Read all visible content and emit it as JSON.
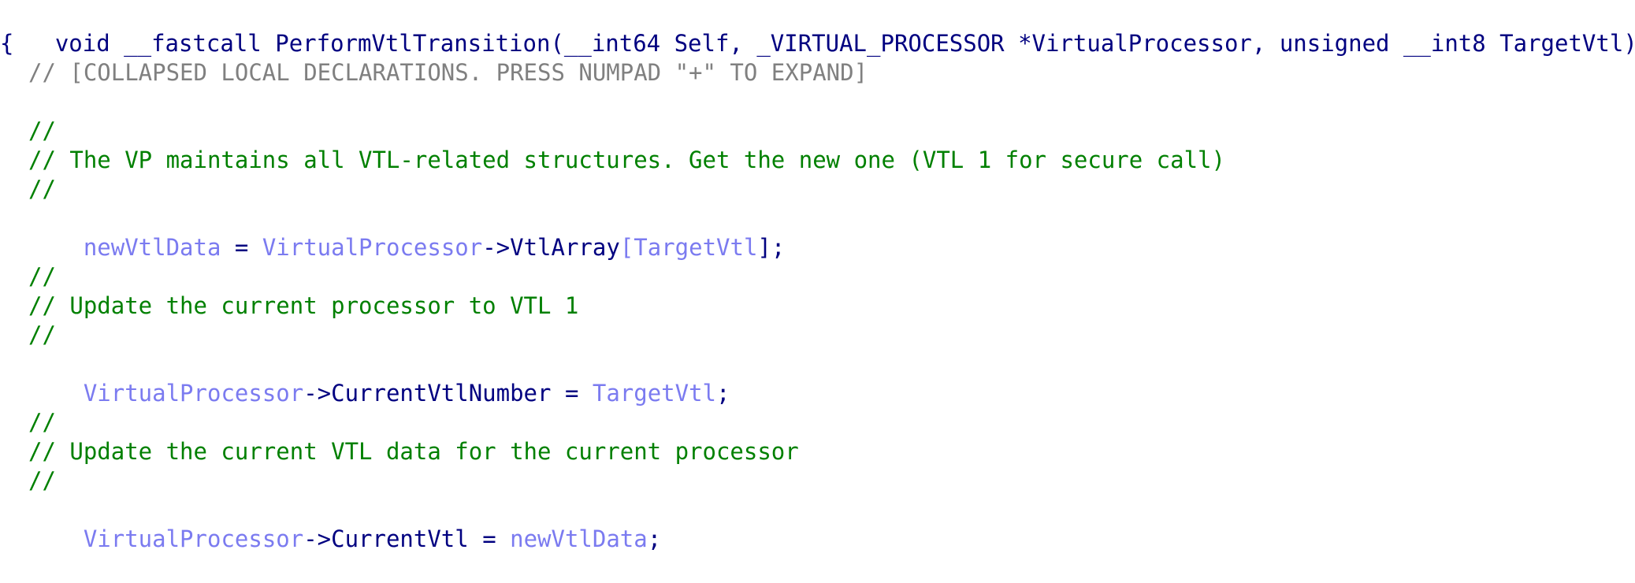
{
  "signature": {
    "ret": "void",
    "conv": "__fastcall",
    "name": "PerformVtlTransition",
    "open": "(",
    "p1": "__int64 Self",
    "sep1": ", ",
    "p2": "_VIRTUAL_PROCESSOR *VirtualProcessor",
    "sep2": ", ",
    "p3": "unsigned __int8 TargetVtl",
    "close": ")"
  },
  "brace_open": "{",
  "collapsed_decls": "// [COLLAPSED LOCAL DECLARATIONS. PRESS NUMPAD \"+\" TO EXPAND]",
  "comments": {
    "c1a": "//",
    "c1b": "// The VP maintains all VTL-related structures. Get the new one (VTL 1 for secure call)",
    "c1c": "//",
    "c2a": "//",
    "c2b": "// Update the current processor to VTL 1",
    "c2c": "//",
    "c3a": "//",
    "c3b": "// Update the current VTL data for the current processor",
    "c3c": "//"
  },
  "stmt1": {
    "lhs": "newVtlData",
    "eq": " = ",
    "obj": "VirtualProcessor",
    "arrow": "->",
    "field": "VtlArray",
    "lb": "[",
    "idx": "TargetVtl",
    "rb": "]",
    "end": ";"
  },
  "stmt2": {
    "obj": "VirtualProcessor",
    "arrow": "->",
    "field": "CurrentVtlNumber",
    "eq": " = ",
    "rhs": "TargetVtl",
    "end": ";"
  },
  "stmt3": {
    "obj": "VirtualProcessor",
    "arrow": "->",
    "field": "CurrentVtl",
    "eq": " = ",
    "rhs": "newVtlData",
    "end": ";"
  },
  "colors": {
    "keyword": "#000080",
    "comment": "#008000",
    "collapsed": "#808080",
    "variable": "#7b7bf0",
    "background": "#ffffff"
  }
}
